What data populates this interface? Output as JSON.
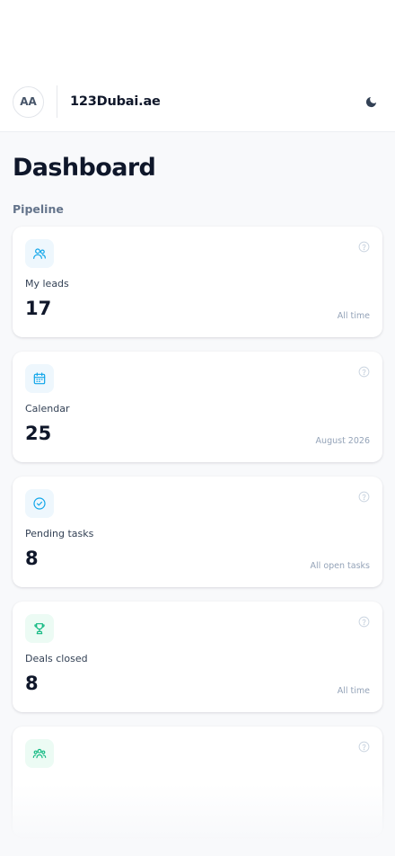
{
  "header": {
    "avatar_initials": "AA",
    "brand": "123Dubai.ae",
    "theme_icon": "moon-icon"
  },
  "main": {
    "title": "Dashboard",
    "section_label": "Pipeline",
    "cards": [
      {
        "icon": "users-icon",
        "icon_color": "#0ea5e9",
        "icon_bg": "#eef7fd",
        "label": "My leads",
        "value": "17",
        "period": "All time"
      },
      {
        "icon": "calendar-icon",
        "icon_color": "#0ea5e9",
        "icon_bg": "#eef7fd",
        "label": "Calendar",
        "value": "25",
        "period": "August 2026"
      },
      {
        "icon": "check-circle-icon",
        "icon_color": "#0ea5e9",
        "icon_bg": "#eef7fd",
        "label": "Pending tasks",
        "value": "8",
        "period": "All open tasks"
      },
      {
        "icon": "trophy-icon",
        "icon_color": "#10b981",
        "icon_bg": "#ecfbf4",
        "label": "Deals closed",
        "value": "8",
        "period": "All time"
      },
      {
        "icon": "team-icon",
        "icon_color": "#10b981",
        "icon_bg": "#ecfbf4",
        "label": "",
        "value": "",
        "period": ""
      }
    ]
  },
  "colors": {
    "accent_blue": "#0ea5e9",
    "accent_green": "#10b981",
    "background": "#f8f9fb",
    "text_primary": "#0f172a",
    "text_muted": "#94a3b8"
  }
}
